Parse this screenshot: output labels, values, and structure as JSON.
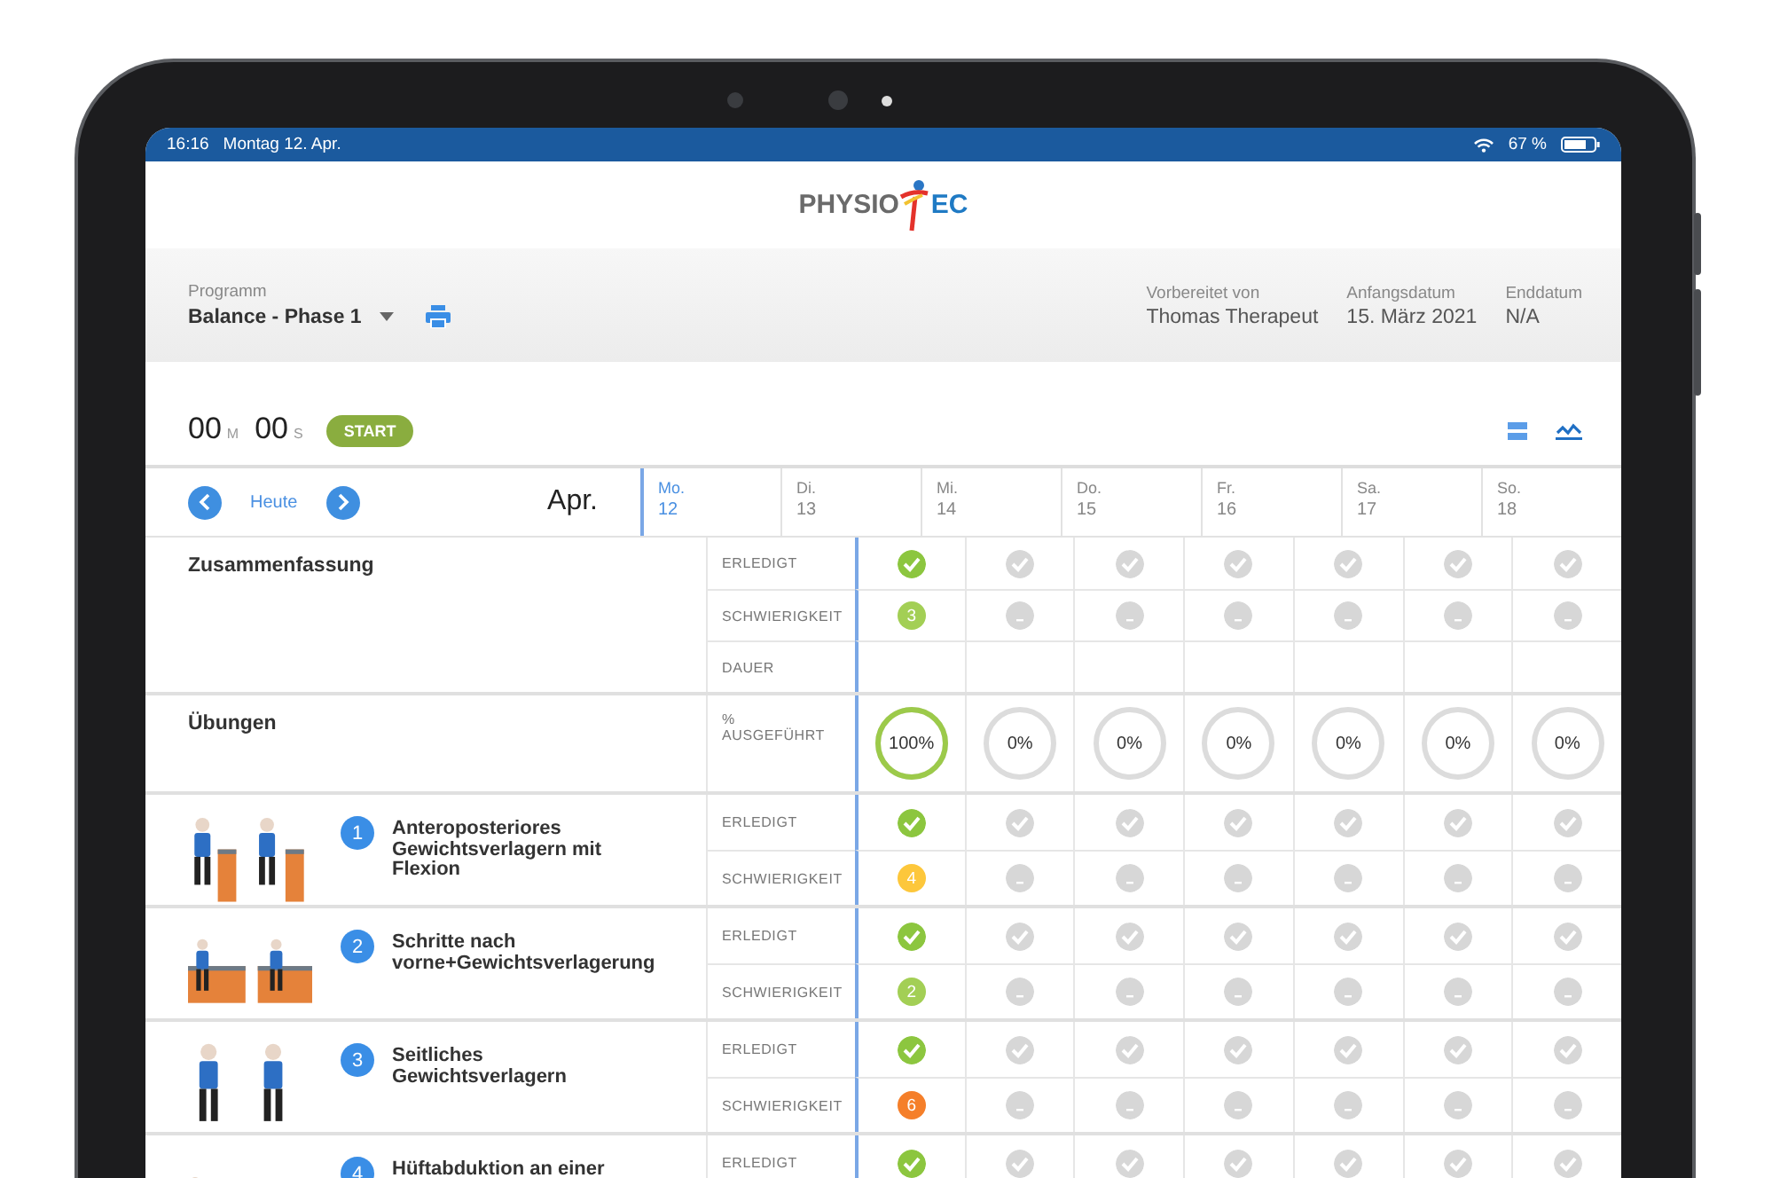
{
  "status_bar": {
    "time": "16:16",
    "date": "Montag 12. Apr.",
    "battery": "67 %"
  },
  "logo": {
    "left": "PHYSIO",
    "right": "EC"
  },
  "program": {
    "label": "Programm",
    "value": "Balance - Phase 1",
    "prepared_by_label": "Vorbereitet von",
    "prepared_by": "Thomas Therapeut",
    "start_label": "Anfangsdatum",
    "start": "15. März 2021",
    "end_label": "Enddatum",
    "end": "N/A"
  },
  "timer": {
    "minutes": "00",
    "minutes_unit": "M",
    "seconds": "00",
    "seconds_unit": "S",
    "button": "START"
  },
  "week": {
    "today": "Heute",
    "month": "Apr.",
    "days": [
      {
        "weekday": "Mo.",
        "date": "12",
        "selected": true
      },
      {
        "weekday": "Di.",
        "date": "13",
        "selected": false
      },
      {
        "weekday": "Mi.",
        "date": "14",
        "selected": false
      },
      {
        "weekday": "Do.",
        "date": "15",
        "selected": false
      },
      {
        "weekday": "Fr.",
        "date": "16",
        "selected": false
      },
      {
        "weekday": "Sa.",
        "date": "17",
        "selected": false
      },
      {
        "weekday": "So.",
        "date": "18",
        "selected": false
      }
    ]
  },
  "summary": {
    "title": "Zusammenfassung",
    "rows": [
      {
        "label": "ERLEDIGT",
        "kind": "done",
        "cells": [
          {
            "done": true
          },
          {
            "done": false
          },
          {
            "done": false
          },
          {
            "done": false
          },
          {
            "done": false
          },
          {
            "done": false
          },
          {
            "done": false
          }
        ]
      },
      {
        "label": "SCHWIERIGKEIT",
        "kind": "difficulty",
        "cells": [
          {
            "value": "3",
            "color": "#a3cf55"
          },
          {
            "rated": false
          },
          {
            "rated": false
          },
          {
            "rated": false
          },
          {
            "rated": false
          },
          {
            "rated": false
          },
          {
            "rated": false
          }
        ]
      },
      {
        "label": "DAUER",
        "kind": "duration"
      }
    ]
  },
  "progress": {
    "title": "Übungen",
    "label": "% AUSGEFÜHRT",
    "cells": [
      {
        "text": "100%",
        "level": 1
      },
      {
        "text": "0%",
        "level": 0
      },
      {
        "text": "0%",
        "level": 0
      },
      {
        "text": "0%",
        "level": 0
      },
      {
        "text": "0%",
        "level": 0
      },
      {
        "text": "0%",
        "level": 0
      },
      {
        "text": "0%",
        "level": 0
      }
    ]
  },
  "exercises": [
    {
      "number": "1",
      "name": "Anteroposteriores Gewichtsverlagern mit Flexion",
      "rows": [
        {
          "label": "ERLEDIGT",
          "kind": "done",
          "cells": [
            {
              "done": true
            },
            {
              "done": false
            },
            {
              "done": false
            },
            {
              "done": false
            },
            {
              "done": false
            },
            {
              "done": false
            },
            {
              "done": false
            }
          ]
        },
        {
          "label": "SCHWIERIGKEIT",
          "kind": "difficulty",
          "cells": [
            {
              "value": "4",
              "color": "#fdc73b"
            },
            {
              "rated": false
            },
            {
              "rated": false
            },
            {
              "rated": false
            },
            {
              "rated": false
            },
            {
              "rated": false
            },
            {
              "rated": false
            }
          ]
        }
      ]
    },
    {
      "number": "2",
      "name": "Schritte nach vorne+Gewichtsverlagerung",
      "rows": [
        {
          "label": "ERLEDIGT",
          "kind": "done",
          "cells": [
            {
              "done": true
            },
            {
              "done": false
            },
            {
              "done": false
            },
            {
              "done": false
            },
            {
              "done": false
            },
            {
              "done": false
            },
            {
              "done": false
            }
          ]
        },
        {
          "label": "SCHWIERIGKEIT",
          "kind": "difficulty",
          "cells": [
            {
              "value": "2",
              "color": "#a3cf55"
            },
            {
              "rated": false
            },
            {
              "rated": false
            },
            {
              "rated": false
            },
            {
              "rated": false
            },
            {
              "rated": false
            },
            {
              "rated": false
            }
          ]
        }
      ]
    },
    {
      "number": "3",
      "name": "Seitliches Gewichtsverlagern",
      "rows": [
        {
          "label": "ERLEDIGT",
          "kind": "done",
          "cells": [
            {
              "done": true
            },
            {
              "done": false
            },
            {
              "done": false
            },
            {
              "done": false
            },
            {
              "done": false
            },
            {
              "done": false
            },
            {
              "done": false
            }
          ]
        },
        {
          "label": "SCHWIERIGKEIT",
          "kind": "difficulty",
          "cells": [
            {
              "value": "6",
              "color": "#f57f2a"
            },
            {
              "rated": false
            },
            {
              "rated": false
            },
            {
              "rated": false
            },
            {
              "rated": false
            },
            {
              "rated": false
            },
            {
              "rated": false
            }
          ]
        }
      ]
    },
    {
      "number": "4",
      "name": "Hüftabduktion an einer",
      "rows": [
        {
          "label": "ERLEDIGT",
          "kind": "done",
          "cells": [
            {
              "done": true
            },
            {
              "done": false
            },
            {
              "done": false
            },
            {
              "done": false
            },
            {
              "done": false
            },
            {
              "done": false
            },
            {
              "done": false
            }
          ]
        }
      ]
    }
  ]
}
